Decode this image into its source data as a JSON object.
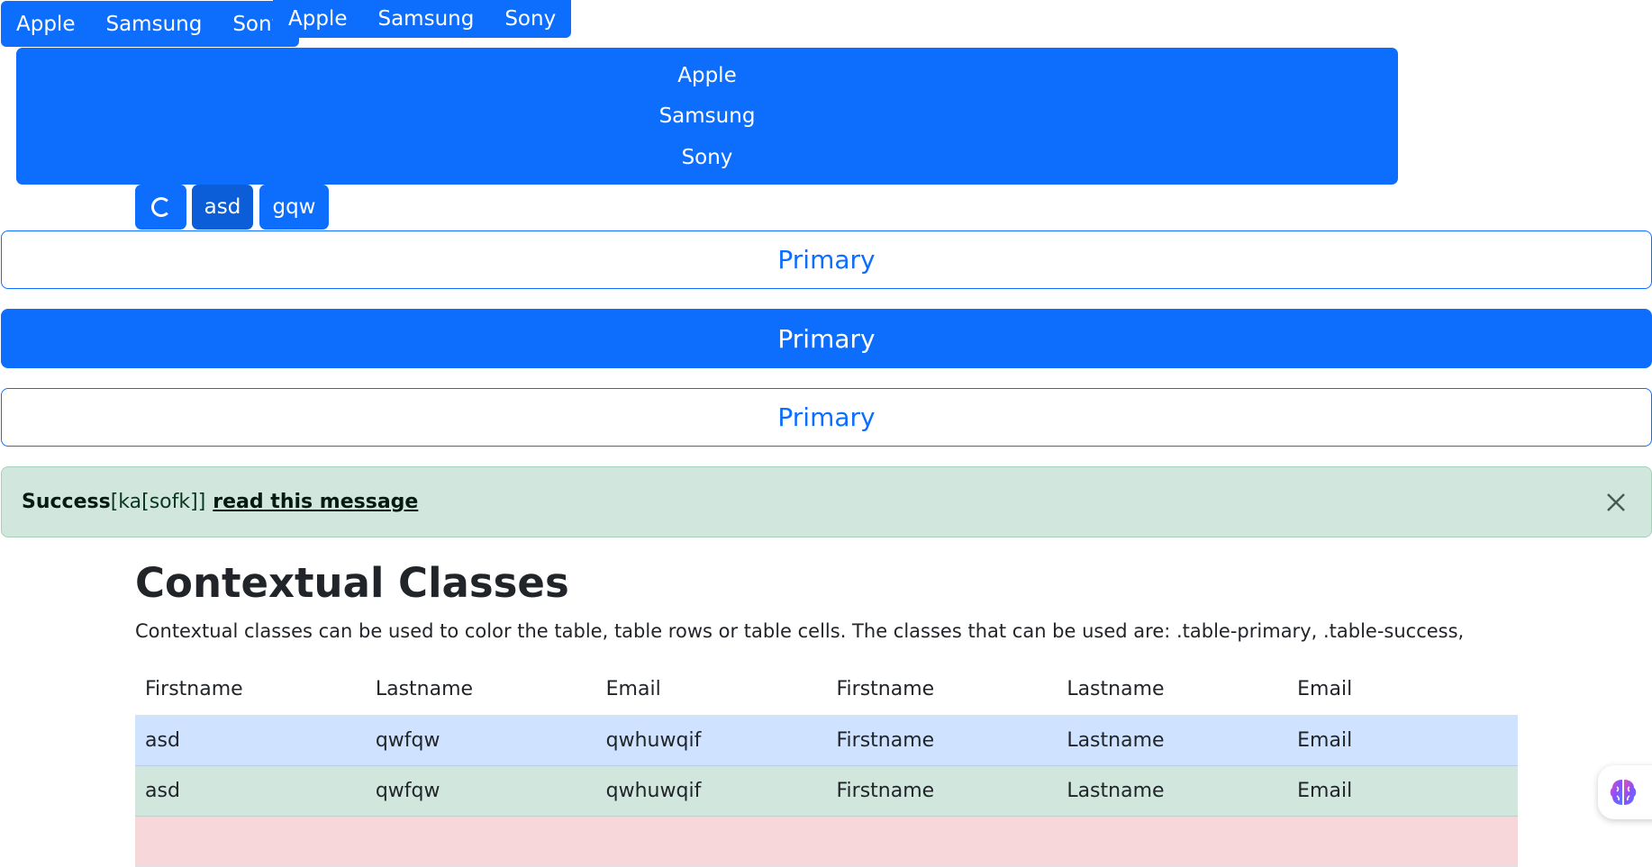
{
  "button_group_1": [
    "Apple",
    "Samsung",
    "Sony"
  ],
  "button_group_2": [
    "Apple",
    "Samsung",
    "Sony"
  ],
  "vertical_group": [
    "Apple",
    "Samsung",
    "Sony"
  ],
  "small_buttons": {
    "active_label": "asd",
    "second_label": "gqw"
  },
  "primary_buttons": [
    "Primary",
    "Primary",
    "Primary"
  ],
  "alert": {
    "strong": "Success",
    "text": "[ka[sofk]]",
    "link": "read this message"
  },
  "heading": "Contextual Classes",
  "paragraph": "Contextual classes can be used to color the table, table rows or table cells. The classes that can be used are: .table-primary, .table-success,",
  "table": {
    "headers": [
      "Firstname",
      "Lastname",
      "Email",
      "Firstname",
      "Lastname",
      "Email"
    ],
    "rows": [
      [
        "asd",
        "qwfqw",
        "qwhuwqif",
        "Firstname",
        "Lastname",
        "Email"
      ],
      [
        "asd",
        "qwfqw",
        "qwhuwqif",
        "Firstname",
        "Lastname",
        "Email"
      ]
    ]
  },
  "colors": {
    "primary": "#0d6efd",
    "success_bg": "#d1e7dd",
    "danger_bg": "#f8d7da"
  },
  "icons": [
    "spinner-icon",
    "close-icon",
    "brain-icon"
  ]
}
